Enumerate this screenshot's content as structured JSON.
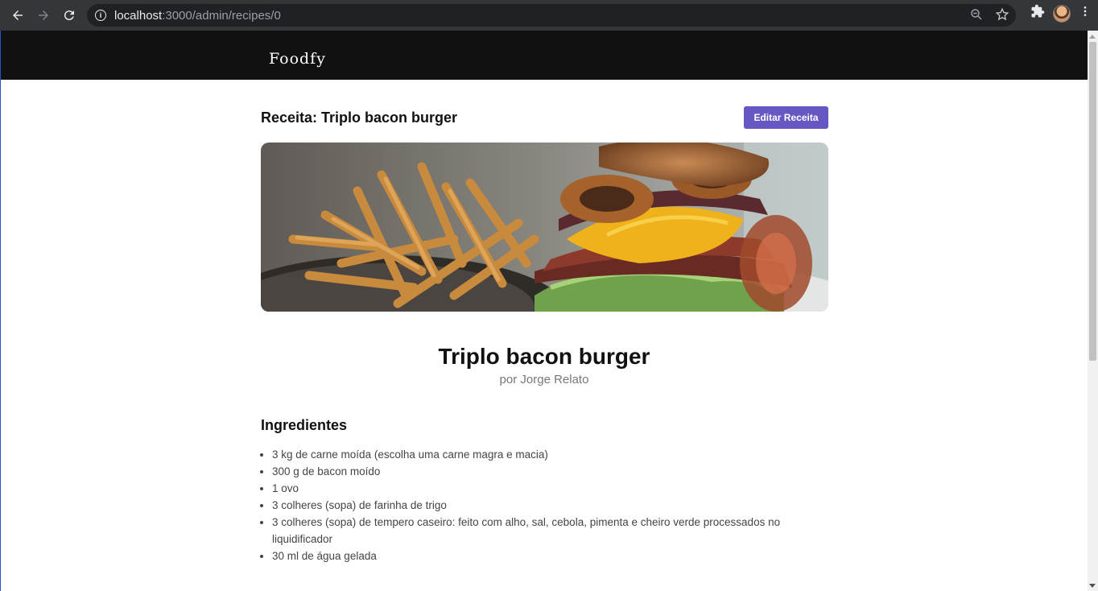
{
  "browser": {
    "url_host": "localhost",
    "url_path": ":3000/admin/recipes/0"
  },
  "site": {
    "logo": "Foodfy"
  },
  "page": {
    "heading": "Receita: Triplo bacon burger",
    "edit_button": "Editar Receita",
    "recipe_title": "Triplo bacon burger",
    "author": "por Jorge Relato",
    "ingredients_title": "Ingredientes",
    "ingredients": [
      "3 kg de carne moída (escolha uma carne magra e macia)",
      "300 g de bacon moído",
      "1 ovo",
      "3 colheres (sopa) de farinha de trigo",
      "3 colheres (sopa) de tempero caseiro: feito com alho, sal, cebola, pimenta e cheiro verde processados no liquidificador",
      "30 ml de água gelada"
    ]
  },
  "colors": {
    "header_bg": "#111111",
    "button_bg": "#6558c3",
    "author_text": "#777777"
  },
  "icons": [
    "back-arrow-icon",
    "forward-arrow-icon",
    "reload-icon",
    "info-icon",
    "zoom-icon",
    "star-icon",
    "extensions-icon",
    "menu-dots-icon"
  ]
}
